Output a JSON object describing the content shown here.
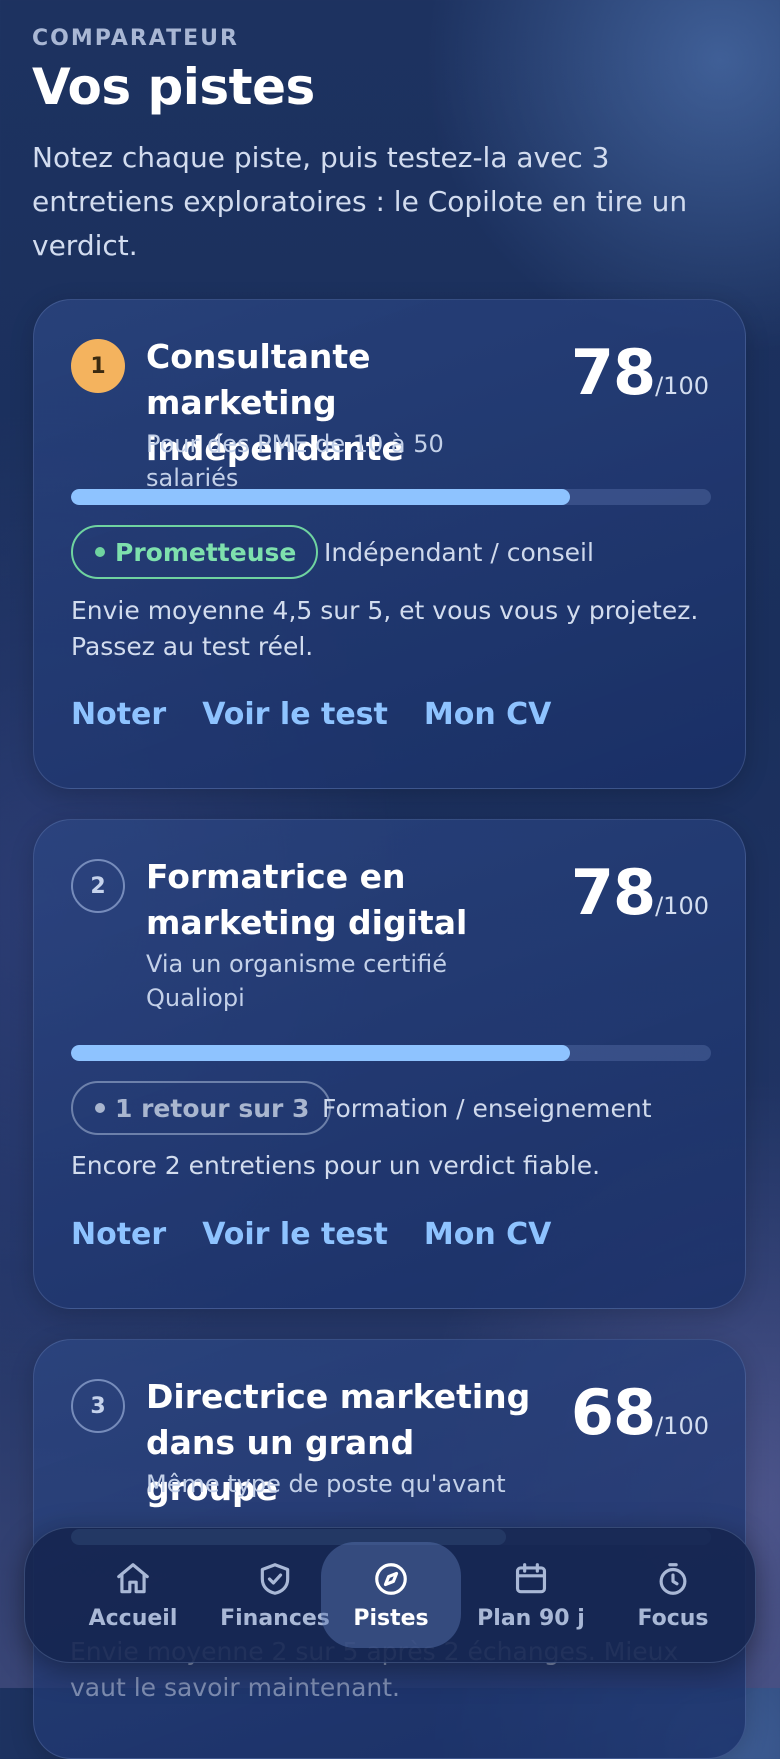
{
  "header": {
    "eyebrow": "COMPARATEUR",
    "title": "Vos pistes",
    "intro": "Notez chaque piste, puis testez-la avec 3 entretiens exploratoires : le Copilote en tire un verdict."
  },
  "cards": [
    {
      "rank": "1",
      "title": "Consultante marketing indépendante",
      "subtitle": "Pour des PME de 10 à 50 salariés",
      "score": "78",
      "score_max": "/100",
      "progress": 0.78,
      "status": "Prometteuse",
      "category": "Indépendant / conseil",
      "description": "Envie moyenne 4,5 sur 5, et vous vous y projetez. Passez au test réel.",
      "actions": {
        "rate": "Noter",
        "test": "Voir le test",
        "cv": "Mon CV"
      }
    },
    {
      "rank": "2",
      "title": "Formatrice en marketing digital",
      "subtitle": "Via un organisme certifié Qualiopi",
      "score": "78",
      "score_max": "/100",
      "progress": 0.78,
      "status": "1 retour sur 3",
      "category": "Formation / enseignement",
      "description": "Encore 2 entretiens pour un verdict fiable.",
      "actions": {
        "rate": "Noter",
        "test": "Voir le test",
        "cv": "Mon CV"
      }
    },
    {
      "rank": "3",
      "title": "Directrice marketing dans un grand groupe",
      "subtitle": "Même type de poste qu'avant",
      "score": "68",
      "score_max": "/100",
      "progress": 0.68,
      "description": "Envie moyenne 2 sur 5 après 2 échanges. Mieux vaut le savoir maintenant."
    }
  ],
  "nav": {
    "items": [
      {
        "label": "Accueil",
        "icon": "home-icon"
      },
      {
        "label": "Finances",
        "icon": "shield-check-icon"
      },
      {
        "label": "Pistes",
        "icon": "compass-icon",
        "active": true
      },
      {
        "label": "Plan 90 j",
        "icon": "calendar-icon"
      },
      {
        "label": "Focus",
        "icon": "timer-icon"
      }
    ]
  },
  "colors": {
    "accent": "#8ec3ff",
    "rank_active": "#f4b35e",
    "status_good": "#6fd3a0",
    "status_neutral": "#a9b6cf"
  }
}
